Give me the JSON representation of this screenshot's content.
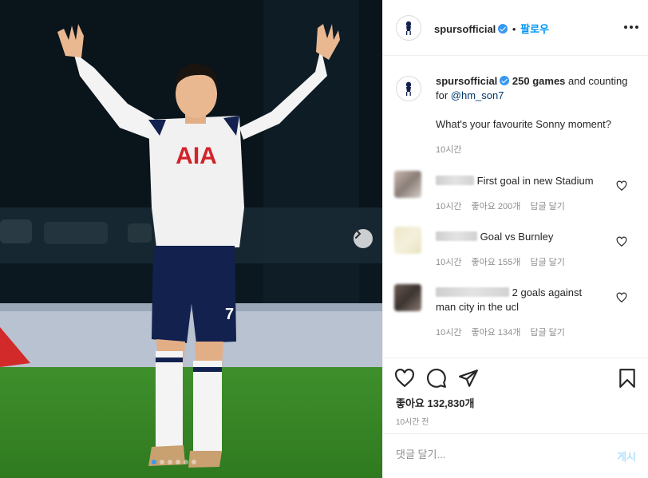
{
  "account": {
    "username": "spursofficial",
    "follow_label": "팔로우"
  },
  "caption": {
    "username": "spursofficial",
    "highlight": "250 games",
    "text_before_mention": " and counting for ",
    "mention": "@hm_son7",
    "question": "What's your favourite Sonny moment?",
    "time": "10시간"
  },
  "comments": [
    {
      "text": "First goal in new Stadium",
      "time": "10시간",
      "likes": "좋아요 200개",
      "reply": "답글 달기"
    },
    {
      "text": "Goal vs Burnley",
      "time": "10시간",
      "likes": "좋아요 155개",
      "reply": "답글 달기"
    },
    {
      "text": "2 goals against",
      "text2": "man city in the ucl",
      "time": "10시간",
      "likes": "좋아요 134개",
      "reply": "답글 달기"
    }
  ],
  "post": {
    "likes": "좋아요 132,830개",
    "time": "10시간 전"
  },
  "comment_box": {
    "placeholder": "댓글 달기...",
    "post_label": "게시"
  },
  "photo": {
    "jersey_sponsor": "AIA",
    "shirt_number": "7",
    "slide_count": 6,
    "active_slide": 0
  },
  "icons": [
    "spurs-logo-icon",
    "verified-icon",
    "heart-icon",
    "comment-icon",
    "share-icon",
    "bookmark-icon",
    "chevron-right-icon",
    "more-icon"
  ],
  "colors": {
    "accent": "#0095f6",
    "verified": "#3897f0",
    "sponsor_red": "#d2232a",
    "shorts_navy": "#13214e"
  }
}
